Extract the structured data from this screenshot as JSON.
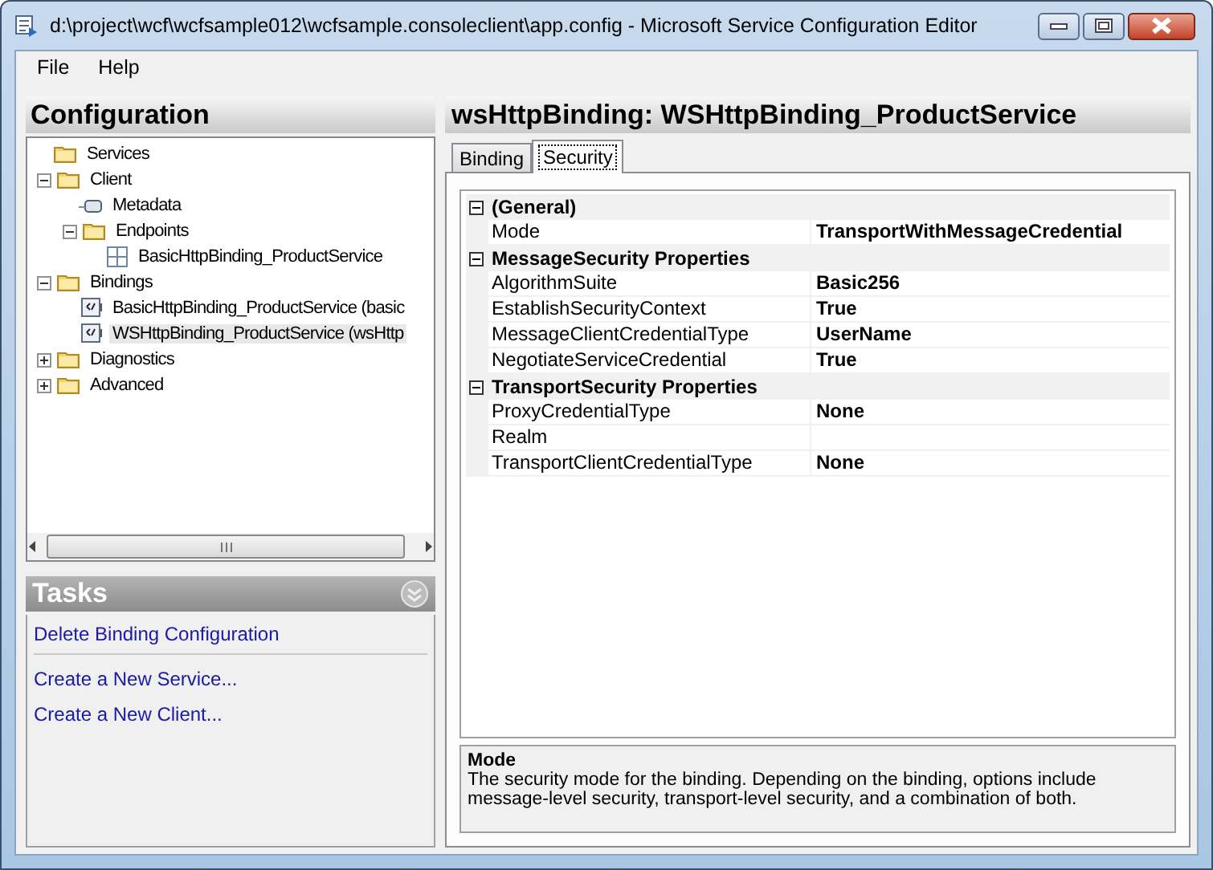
{
  "window": {
    "title": "d:\\project\\wcf\\wcfsample012\\wcfsample.consoleclient\\app.config - Microsoft Service Configuration Editor"
  },
  "menu": [
    "File",
    "Help"
  ],
  "configuration": {
    "title": "Configuration",
    "tree": [
      {
        "label": "Services",
        "kind": "folder"
      },
      {
        "label": "Client",
        "kind": "folder",
        "expanded": true,
        "children": [
          {
            "label": "Metadata",
            "kind": "metadata"
          },
          {
            "label": "Endpoints",
            "kind": "folder",
            "expanded": true,
            "children": [
              {
                "label": "BasicHttpBinding_ProductService",
                "kind": "endpoint",
                "selected": false
              }
            ]
          }
        ]
      },
      {
        "label": "Bindings",
        "kind": "folder",
        "expanded": true,
        "children": [
          {
            "label": "BasicHttpBinding_ProductService (basic",
            "kind": "binding",
            "selected": false
          },
          {
            "label": "WSHttpBinding_ProductService (wsHttp",
            "kind": "binding",
            "selected": true
          }
        ]
      },
      {
        "label": "Diagnostics",
        "kind": "folder",
        "expanded": false
      },
      {
        "label": "Advanced",
        "kind": "folder",
        "expanded": false
      }
    ]
  },
  "tasks": {
    "title": "Tasks",
    "groups": [
      [
        "Delete Binding Configuration"
      ],
      [
        "Create a New Service...",
        "Create a New Client..."
      ]
    ]
  },
  "editor": {
    "title": "wsHttpBinding: WSHttpBinding_ProductService",
    "tabs": [
      {
        "label": "Binding",
        "selected": false
      },
      {
        "label": "Security",
        "selected": true
      }
    ],
    "categories": [
      {
        "name": "(General)",
        "expanded": true,
        "properties": [
          {
            "name": "Mode",
            "value": "TransportWithMessageCredential"
          }
        ]
      },
      {
        "name": "MessageSecurity Properties",
        "expanded": true,
        "properties": [
          {
            "name": "AlgorithmSuite",
            "value": "Basic256"
          },
          {
            "name": "EstablishSecurityContext",
            "value": "True"
          },
          {
            "name": "MessageClientCredentialType",
            "value": "UserName"
          },
          {
            "name": "NegotiateServiceCredential",
            "value": "True"
          }
        ]
      },
      {
        "name": "TransportSecurity Properties",
        "expanded": true,
        "properties": [
          {
            "name": "ProxyCredentialType",
            "value": "None"
          },
          {
            "name": "Realm"
          },
          {
            "name": "TransportClientCredentialType",
            "value": "None"
          }
        ]
      }
    ],
    "description": {
      "title": "Mode",
      "text": "The security mode for the binding. Depending on the binding, options include message-level security, transport-level security, and a combination of both."
    }
  }
}
